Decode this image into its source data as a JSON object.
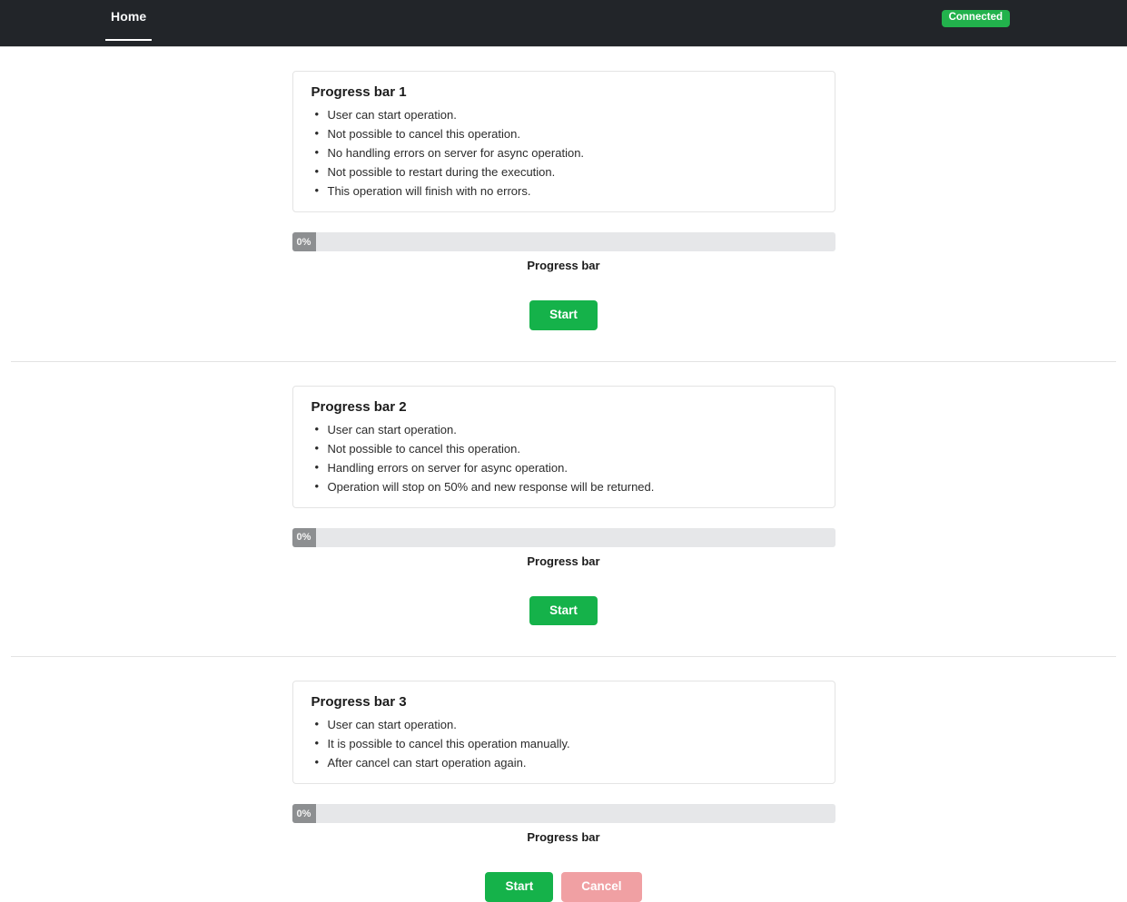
{
  "header": {
    "tabs": [
      {
        "label": "Home",
        "active": true
      }
    ],
    "status": {
      "label": "Connected",
      "color": "#22b24c"
    }
  },
  "sections": [
    {
      "card": {
        "title": "Progress bar 1",
        "items": [
          "User can start operation.",
          "Not possible to cancel this operation.",
          "No handling errors on server for async operation.",
          "Not possible to restart during the execution.",
          "This operation will finish with no errors."
        ]
      },
      "progress": {
        "value": 0,
        "value_text": "0%",
        "label": "Progress bar",
        "track_color": "#e6e7e9",
        "fill_color": "#8d8f91"
      },
      "buttons": [
        {
          "label": "Start",
          "style": "start",
          "color": "#15b24a"
        }
      ]
    },
    {
      "card": {
        "title": "Progress bar 2",
        "items": [
          "User can start operation.",
          "Not possible to cancel this operation.",
          "Handling errors on server for async operation.",
          "Operation will stop on 50% and new response will be returned."
        ]
      },
      "progress": {
        "value": 0,
        "value_text": "0%",
        "label": "Progress bar",
        "track_color": "#e6e7e9",
        "fill_color": "#8d8f91"
      },
      "buttons": [
        {
          "label": "Start",
          "style": "start",
          "color": "#15b24a"
        }
      ]
    },
    {
      "card": {
        "title": "Progress bar 3",
        "items": [
          "User can start operation.",
          "It is possible to cancel this operation manually.",
          "After cancel can start operation again."
        ]
      },
      "progress": {
        "value": 0,
        "value_text": "0%",
        "label": "Progress bar",
        "track_color": "#e6e7e9",
        "fill_color": "#8d8f91"
      },
      "buttons": [
        {
          "label": "Start",
          "style": "start",
          "color": "#15b24a"
        },
        {
          "label": "Cancel",
          "style": "cancel",
          "color": "#f0a0a3"
        }
      ]
    }
  ]
}
